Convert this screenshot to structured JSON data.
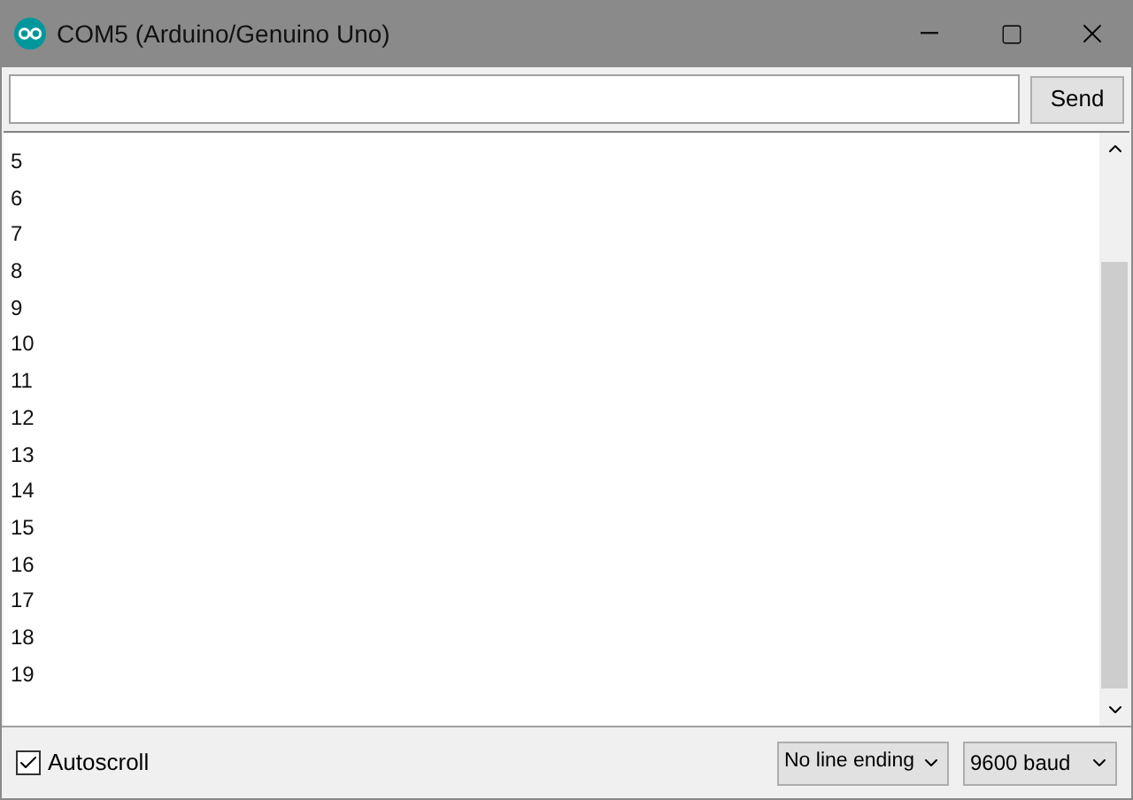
{
  "window": {
    "title": "COM5 (Arduino/Genuino Uno)"
  },
  "send_button": "Send",
  "output_lines": [
    "5",
    "6",
    "7",
    "8",
    "9",
    "10",
    "11",
    "12",
    "13",
    "14",
    "15",
    "16",
    "17",
    "18",
    "19"
  ],
  "autoscroll": {
    "label": "Autoscroll",
    "checked": true
  },
  "line_ending": "No line ending",
  "baud": "9600 baud"
}
